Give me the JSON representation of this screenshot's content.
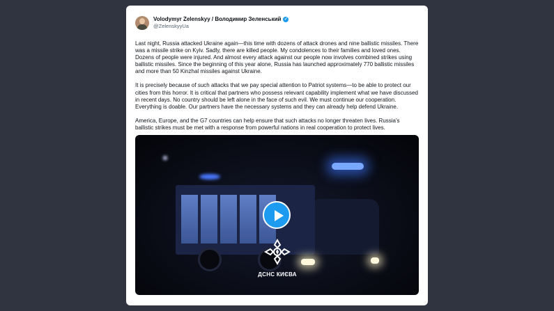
{
  "tweet": {
    "display_name": "Volodymyr Zelenskyy / Володимир Зеленський",
    "handle": "@ZelenskyyUa",
    "verified_icon": "verified-badge-icon",
    "paragraphs": [
      "Last night, Russia attacked Ukraine again—this time with dozens of attack drones and nine ballistic missiles. There was a missile strike on Kyiv. Sadly, there are killed people. My condolences to their families and loved ones. Dozens of people were injured. And almost every attack against our people now involves combined strikes using ballistic missiles. Since the beginning of this year alone, Russia has launched approximately 770 ballistic missiles and more than 50 Kinzhal missiles against Ukraine.",
      "It is precisely because of such attacks that we pay special attention to Patriot systems—to be able to protect our cities from this horror. It is critical that partners who possess relevant capability implement what we have discussed in recent days. No country should be left alone in the face of such evil. We must continue our cooperation. Everything is doable. Our partners have the necessary systems and they can already help defend Ukraine.",
      "America, Europe, and the G7 countries can help ensure that such attacks no longer threaten lives. Russia's ballistic strikes must be met with a response from powerful nations in real cooperation to protect lives."
    ],
    "media": {
      "type": "video",
      "overlay_caption": "ДСНС КИЄВА",
      "play_icon": "play-icon",
      "emblem_icon": "emergency-service-emblem-icon"
    }
  },
  "colors": {
    "background": "#2f3440",
    "card": "#ffffff",
    "accent": "#1d9bf0",
    "text": "#0f1419",
    "muted": "#536471"
  }
}
